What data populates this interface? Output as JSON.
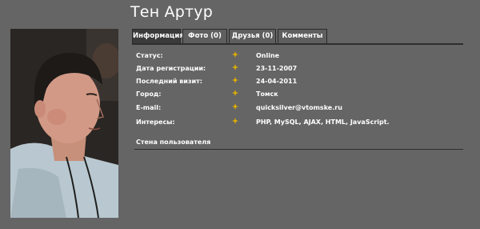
{
  "profile": {
    "name": "Тен Артур",
    "photo_alt": "user-photo"
  },
  "tabs": [
    {
      "label": "Информация",
      "active": true
    },
    {
      "label": "Фото (0)",
      "active": false
    },
    {
      "label": "Друзья (0)",
      "active": false
    },
    {
      "label": "Комменты",
      "active": false
    }
  ],
  "info": [
    {
      "label": "Статус:",
      "value": "Online"
    },
    {
      "label": "Дата регистрации:",
      "value": "23-11-2007"
    },
    {
      "label": "Последний визит:",
      "value": "24-04-2011"
    },
    {
      "label": "Город:",
      "value": "Томск"
    },
    {
      "label": "E-mail:",
      "value": "quicksilver@vtomske.ru"
    },
    {
      "label": "Интересы:",
      "value": "PHP, MySQL, AJAX, HTML, JavaScript."
    }
  ],
  "wall": {
    "title": "Стена пользователя"
  },
  "colors": {
    "background": "#656565",
    "tab_active": "#3b3b3b",
    "bullet": "#e0b000"
  }
}
